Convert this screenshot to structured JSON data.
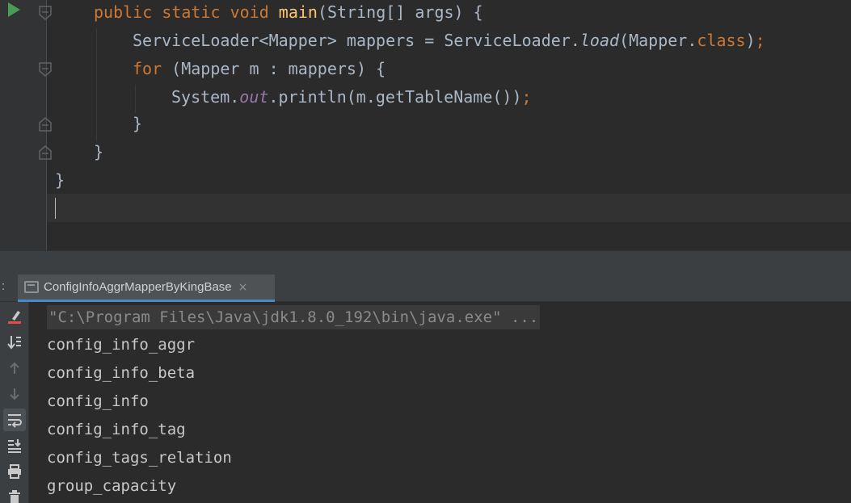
{
  "editor": {
    "lines": [
      {
        "kw1": "public static void ",
        "method": "main",
        "rest": "(String[] args) {"
      },
      {
        "t1": "ServiceLoader<Mapper> mappers = ServiceLoader.",
        "call": "load",
        "t2": "(Mapper.",
        "kw": "class",
        "t3": ")",
        "semi": ";"
      },
      {
        "kw": "for",
        "t1": " (Mapper m : mappers) {"
      },
      {
        "t1": "System.",
        "field": "out",
        "t2": ".println(m.getTableName())",
        "semi": ";"
      },
      {
        "t1": "}"
      },
      {
        "t1": "}"
      },
      {
        "t1": "}"
      }
    ]
  },
  "run": {
    "tab_prefix": ":",
    "tab_label": "ConfigInfoAggrMapperByKingBase",
    "tab_close": "×",
    "command": "\"C:\\Program Files\\Java\\jdk1.8.0_192\\bin\\java.exe\" ...",
    "output": [
      "config_info_aggr",
      "config_info_beta",
      "config_info",
      "config_info_tag",
      "config_tags_relation",
      "group_capacity"
    ]
  },
  "colors": {
    "keyword": "#cc7832",
    "method": "#ffc66d",
    "field": "#9876aa",
    "text": "#a9b7c6",
    "run": "#499c54"
  }
}
